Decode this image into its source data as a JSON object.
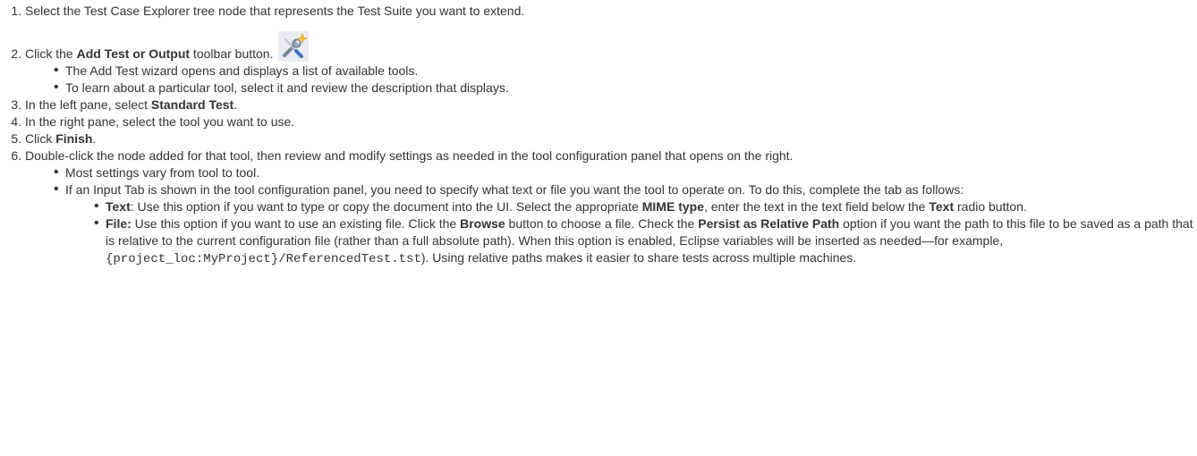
{
  "steps": [
    {
      "text": "Select the Test Case Explorer tree node that represents the Test Suite you want to extend."
    },
    {
      "pre": "Click the ",
      "bold": "Add Test or Output",
      "post": " toolbar button. ",
      "icon": "add-test-toolbar-icon",
      "bullets": [
        "The Add Test wizard opens and displays a list of available tools.",
        "To learn about a particular tool, select it and review the description that displays."
      ]
    },
    {
      "pre": "In the left pane, select ",
      "bold": "Standard Test",
      "post": "."
    },
    {
      "text": "In the right pane, select the tool you want to use."
    },
    {
      "pre": "Click ",
      "bold": "Finish",
      "post": "."
    },
    {
      "text": "Double-click the node added for that tool, then review and modify settings as needed in the tool configuration panel that opens on the right.",
      "bullets": [
        "Most settings vary from tool to tool.",
        "If an Input Tab is shown in the tool configuration panel, you need to specify what  text or file  you want the tool to operate on. To do this, complete the tab as follows:"
      ],
      "sub": {
        "text": {
          "label": "Text",
          "a": ": Use this option if you want to type or copy the document into the UI. Select the appropriate ",
          "b1": "MIME type",
          "c": ", enter the text in the text field below the ",
          "b2": "Text",
          "d": " radio button."
        },
        "file": {
          "label": "File:",
          "a": " Use this option if you want to use an existing file. Click the ",
          "b1": "Browse",
          "c": " button to choose a file. Check the ",
          "b2": "Persist as Relative Path",
          "d": " option if you want the path to this file to be saved as a path that is relative to the current configuration file (rather than a full absolute path). When this option is enabled, Eclipse variables will be inserted as needed—for example, ",
          "code": "{project_loc:MyProject}/ReferencedTest.tst",
          "e": "). Using relative paths makes it easier to share tests across multiple machines."
        }
      }
    }
  ]
}
